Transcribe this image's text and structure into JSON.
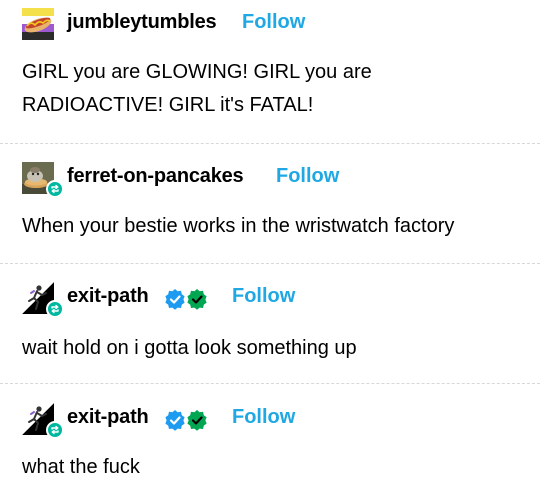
{
  "posts": [
    {
      "username": "jumbleytumbles",
      "follow_label": "Follow",
      "avatar_icon": "hotdog-icon",
      "lines": [
        "GIRL you are GLOWING! GIRL you are",
        "RADIOACTIVE! GIRL it's FATAL!"
      ]
    },
    {
      "username": "ferret-on-pancakes",
      "follow_label": "Follow",
      "avatar_icon": "ferret-pancake-icon",
      "reblog_icon": "reblog-icon",
      "lines": [
        "When your bestie works in the wristwatch factory"
      ]
    },
    {
      "username": "exit-path",
      "follow_label": "Follow",
      "avatar_icon": "exit-path-icon",
      "reblog_icon": "reblog-icon",
      "badge_icons": [
        "blue-checkmark-icon",
        "green-checkmark-icon"
      ],
      "lines": [
        "wait hold on i gotta look something up"
      ]
    },
    {
      "username": "exit-path",
      "follow_label": "Follow",
      "avatar_icon": "exit-path-icon",
      "reblog_icon": "reblog-icon",
      "badge_icons": [
        "blue-checkmark-icon",
        "green-checkmark-icon"
      ],
      "lines": [
        "what the fuck"
      ]
    }
  ],
  "colors": {
    "follow": "#1fa8e3",
    "reblog_badge": "#00b8a0",
    "blue_check": "#1d9bf0",
    "green_check": "#00a651"
  }
}
